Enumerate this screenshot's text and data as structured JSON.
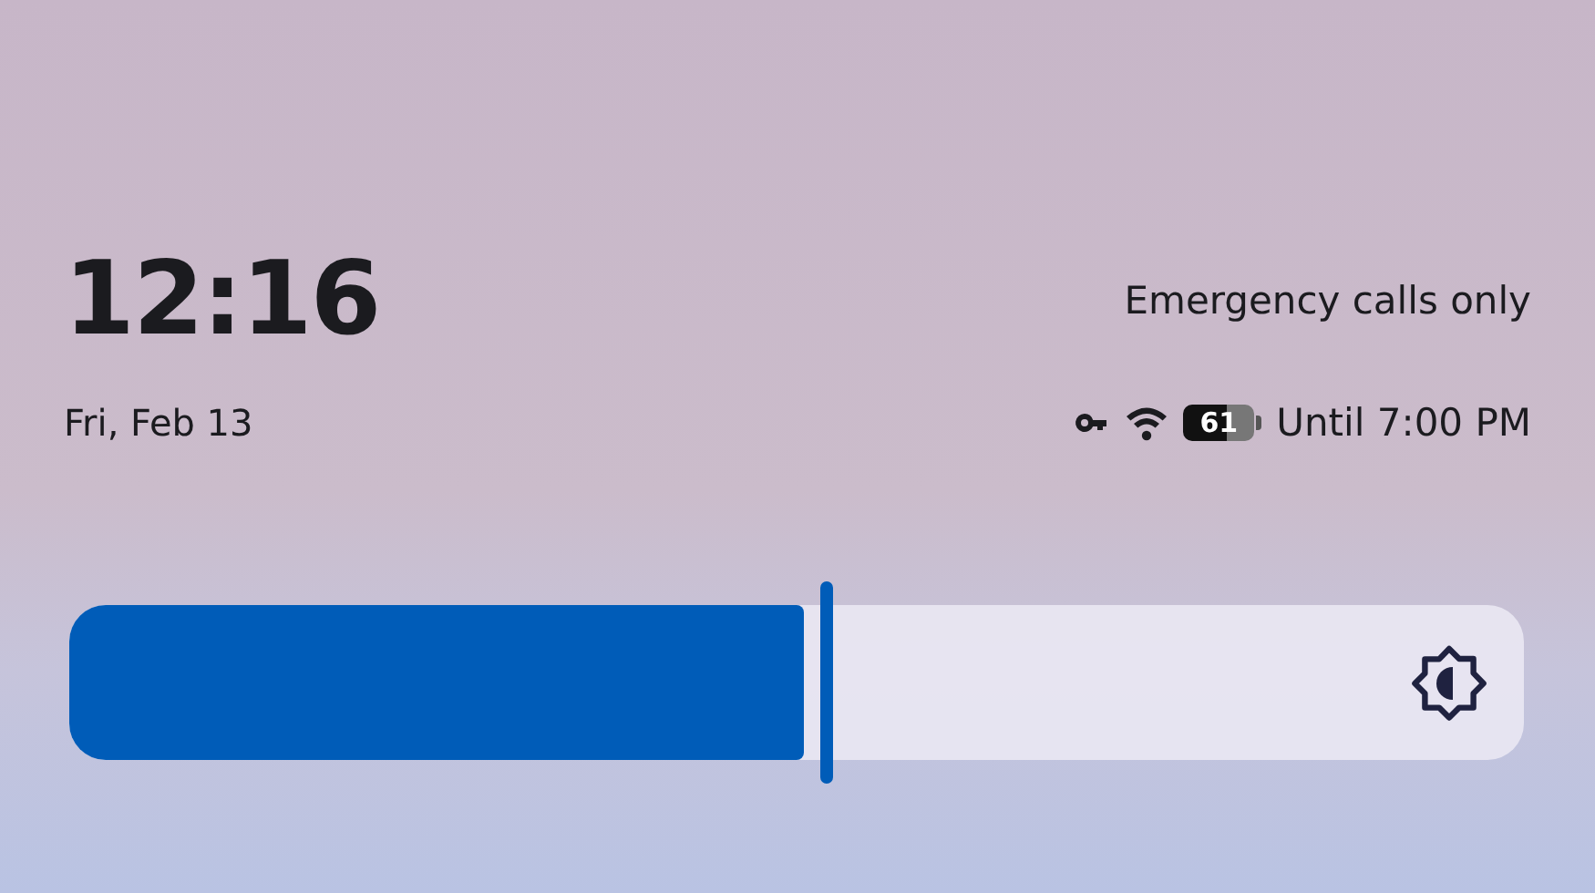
{
  "clock": {
    "time": "12:16",
    "date": "Fri, Feb 13"
  },
  "carrier": "Emergency calls only",
  "status": {
    "battery": "61",
    "battery_estimate": "Until 7:00 PM"
  },
  "brightness": {
    "level": 0.52
  }
}
